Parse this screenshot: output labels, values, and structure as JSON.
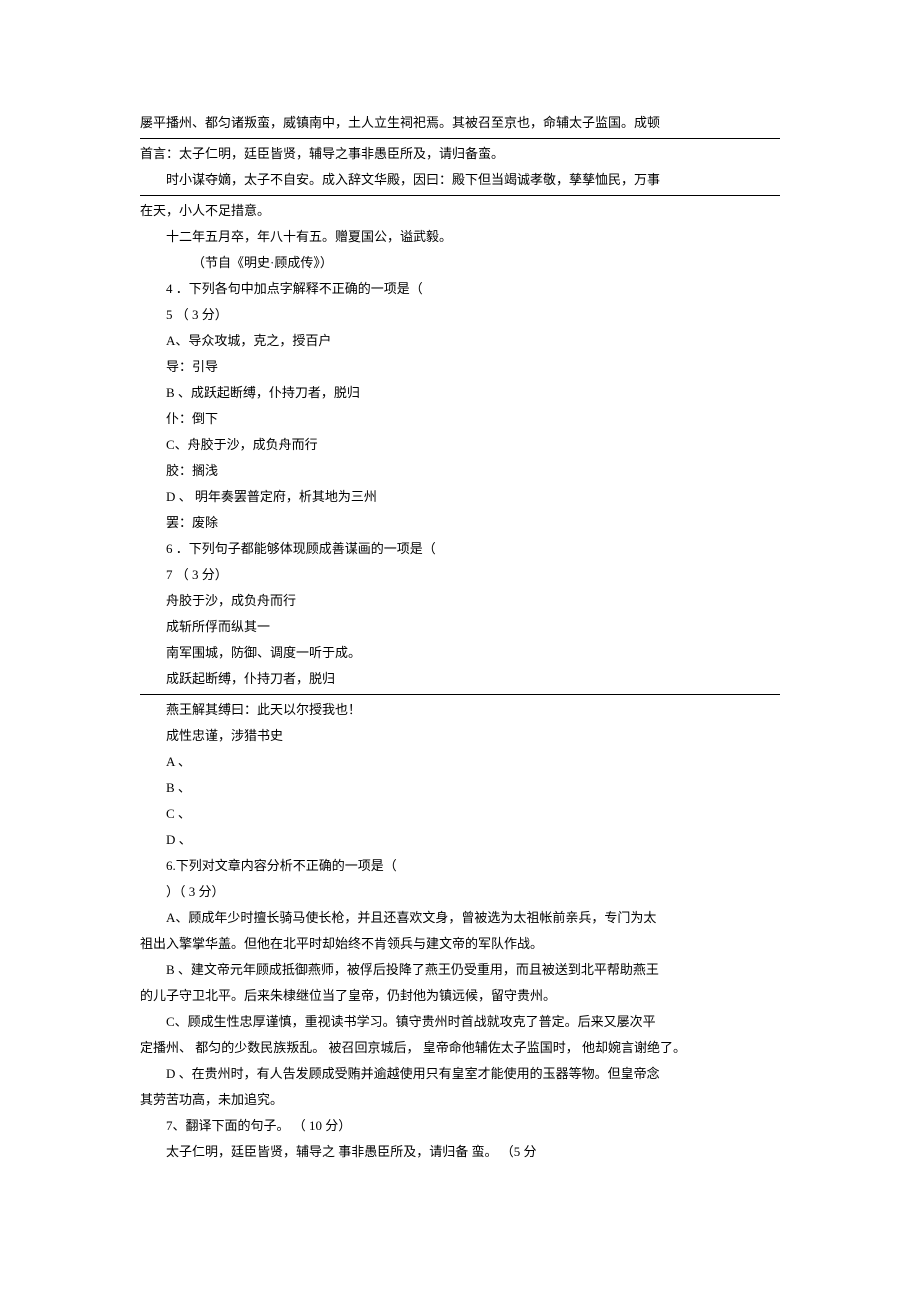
{
  "lines": {
    "l1": "屡平播州、都匀诸叛蛮，威镇南中，土人立生祠祀焉。其被召至京也，命辅太子监国。成顿",
    "l2": "首言：太子仁明，廷臣皆贤，辅导之事非愚臣所及，请归备蛮。",
    "l3": "时小谋夺嫡，太子不自安。成入辞文华殿，因曰：殿下但当竭诚孝敬，孳孳恤民，万事",
    "l4": "在天，小人不足措意。",
    "l5": "十二年五月卒，年八十有五。赠夏国公，谥武毅。",
    "l6": "（节自《明史·顾成传》）",
    "l7": "4 ．下列各句中加点字解释不正确的一项是（",
    "l8": "5 （  3 分）",
    "l9": "A、导众攻城，克之，授百户",
    "l10": "导：引导",
    "l11": "B 、成跃起断缚，仆持刀者，脱归",
    "l12": "仆：倒下",
    "l13": "C、舟胶于沙，成负舟而行",
    "l14": "胶：搁浅",
    "l15": "D 、 明年奏罢普定府，析其地为三州",
    "l16": "罢：废除",
    "l17": "6 ．下列句子都能够体现顾成善谋画的一项是（",
    "l18": "7 （  3 分）",
    "l19": "舟胶于沙，成负舟而行",
    "l20": "成斩所俘而纵其一",
    "l21": "南军围城，防御、调度一听于成。",
    "l22": "成跃起断缚，仆持刀者，脱归",
    "l23": "燕王解其缚曰：此天以尔授我也！",
    "l24": "成性忠谨，涉猎书史",
    "l25": "A 、",
    "l26": "B 、",
    "l27": "C 、",
    "l28": "D 、",
    "l29": "6.下列对文章内容分析不正确的一项是（",
    "l30": "）（ 3 分）",
    "l31": "A、顾成年少时擅长骑马使长枪，并且还喜欢文身，曾被选为太祖帐前亲兵，专门为太",
    "l32": "祖出入擎掌华盖。但他在北平时却始终不肯领兵与建文帝的军队作战。",
    "l33": "B 、建文帝元年顾成抵御燕师，被俘后投降了燕王仍受重用，而且被送到北平帮助燕王",
    "l34": "的儿子守卫北平。后来朱棣继位当了皇帝，仍封他为镇远候，留守贵州。",
    "l35": "C、顾成生性忠厚谨慎，重视读书学习。镇守贵州时首战就攻克了普定。后来又屡次平",
    "l36": "定播州、  都匀的少数民族叛乱。  被召回京城后，  皇帝命他辅佐太子监国时，  他却婉言谢绝了。",
    "l37": "D 、在贵州时，有人告发顾成受贿并逾越使用只有皇室才能使用的玉器等物。但皇帝念",
    "l38": "其劳苦功高，未加追究。",
    "l39": "7、翻译下面的句子。 （ 10 分）",
    "l40": "太子仁明，廷臣皆贤，辅导之  事非愚臣所及，请归备  蛮。 （5 分"
  }
}
